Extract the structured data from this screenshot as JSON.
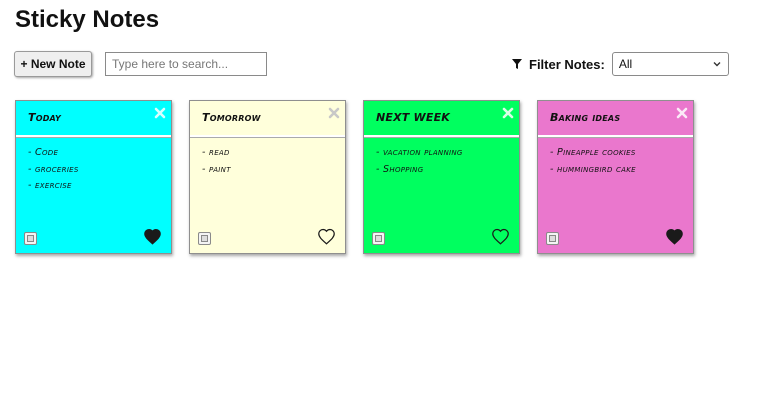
{
  "app": {
    "title": "Sticky Notes"
  },
  "toolbar": {
    "new_note_label": "+ New Note",
    "search_placeholder": "Type here to search...",
    "filter_label": "Filter Notes:",
    "filter_icon": "funnel-icon",
    "filter_selected": "All"
  },
  "notes": [
    {
      "title": "Today",
      "color": "#00FFFF",
      "items": [
        "- Code",
        "- groceries",
        "- exercise"
      ],
      "favorited": true
    },
    {
      "title": "Tomorrow",
      "color": "#FFFFDB",
      "items": [
        "- read",
        "- paint"
      ],
      "favorited": false
    },
    {
      "title": "NEXT WEEK",
      "color": "#00FF5F",
      "items": [
        "- vacation planning",
        "- Shopping"
      ],
      "favorited": false
    },
    {
      "title": "Baking ideas",
      "color": "#EA77CD",
      "items": [
        "- Pineapple cookies",
        "- hummingbird cake"
      ],
      "favorited": true
    }
  ],
  "icons": {
    "close": "close-icon",
    "favorite": "heart-icon",
    "select": "checkbox"
  }
}
